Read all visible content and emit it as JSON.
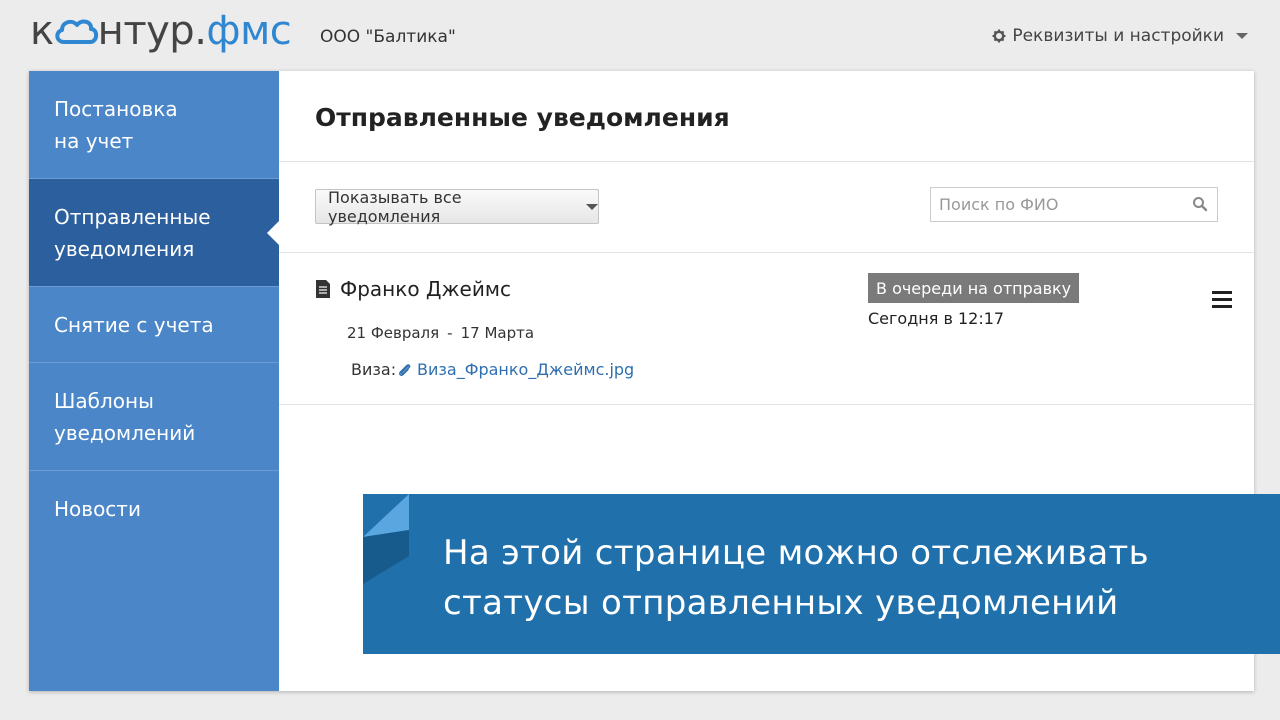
{
  "header": {
    "logo_left": "к",
    "logo_right": "нтур.",
    "logo_accent": "фмс",
    "org_name": "ООО \"Балтика\"",
    "settings_label": "Реквизиты и настройки"
  },
  "sidebar": {
    "items": [
      {
        "line1": "Постановка",
        "line2": "на учет"
      },
      {
        "line1": "Отправленные",
        "line2": "уведомления"
      },
      {
        "line1": "Снятие с учета",
        "line2": ""
      },
      {
        "line1": "Шаблоны",
        "line2": "уведомлений"
      },
      {
        "line1": "Новости",
        "line2": ""
      }
    ]
  },
  "main": {
    "title": "Отправленные уведомления",
    "filter_label": "Показывать все уведомления",
    "search_placeholder": "Поиск по ФИО"
  },
  "notification": {
    "name": "Франко Джеймс",
    "date_from": "21 Февраля",
    "date_sep": "-",
    "date_to": "17 Марта",
    "visa_label": "Виза:",
    "visa_file": "Виза_Франко_Джеймс.jpg",
    "status": "В очереди на отправку",
    "status_time": "Сегодня в 12:17"
  },
  "banner": {
    "line1": "На этой странице можно отслеживать",
    "line2": "статусы отправленных уведомлений"
  },
  "colors": {
    "sidebar": "#4a86c8",
    "sidebar_active": "#2c5f9e",
    "accent": "#2f86d1",
    "banner": "#1f70ab",
    "status_badge": "#7a7a7a"
  }
}
